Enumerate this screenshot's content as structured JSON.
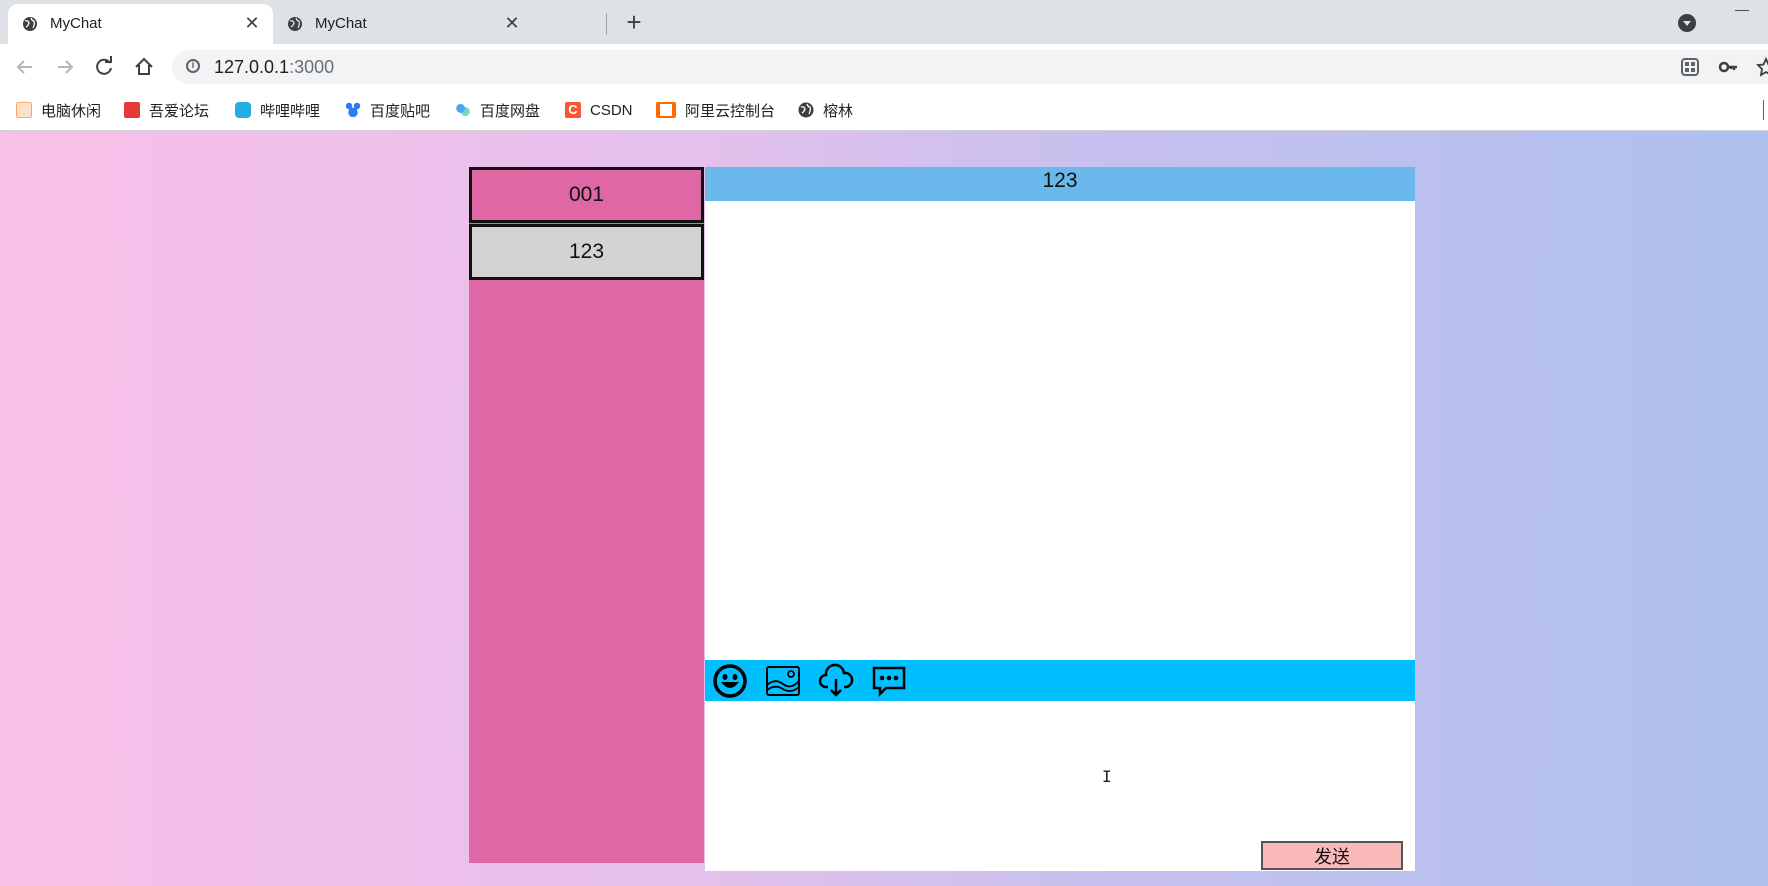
{
  "browser": {
    "tabs": [
      {
        "title": "MyChat",
        "active": true,
        "close": "✕"
      },
      {
        "title": "MyChat",
        "active": false,
        "close": "✕"
      }
    ],
    "new_tab": "+",
    "url_host": "127.0.0.1",
    "url_port": ":3000",
    "bookmarks": [
      {
        "label": "电脑休闲",
        "color": "#f6a96b"
      },
      {
        "label": "吾爱论坛",
        "color": "#e53935"
      },
      {
        "label": "哔哩哔哩",
        "color": "#23ade5"
      },
      {
        "label": "百度贴吧",
        "color": "#2d7cf6"
      },
      {
        "label": "百度网盘",
        "color": "#4ba3f5"
      },
      {
        "label": "CSDN",
        "color": "#fc5531"
      },
      {
        "label": "阿里云控制台",
        "color": "#ff6a00"
      },
      {
        "label": "榕林",
        "color": "#3c4043"
      }
    ]
  },
  "app": {
    "friends": [
      {
        "name": "001"
      },
      {
        "name": "123"
      }
    ],
    "chat_title": "123",
    "tools": [
      "emoji-icon",
      "image-icon",
      "cloud-download-icon",
      "chat-bubble-icon"
    ],
    "send_label": "发送",
    "colors": {
      "sidebar": "#e067a6",
      "selected_friend": "#d3d3d3",
      "header": "#6ab8ec",
      "toolbar": "#00bffe",
      "send_button": "#fbb8b8"
    }
  }
}
